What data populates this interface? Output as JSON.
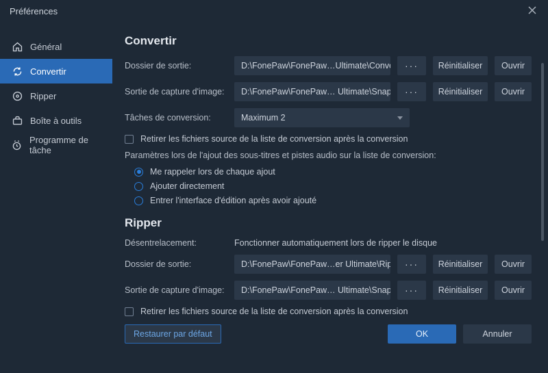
{
  "titlebar": {
    "title": "Préférences"
  },
  "sidebar": {
    "items": [
      {
        "label": "Général"
      },
      {
        "label": "Convertir"
      },
      {
        "label": "Ripper"
      },
      {
        "label": "Boîte à outils"
      },
      {
        "label": "Programme de tâche"
      }
    ],
    "active_index": 1
  },
  "convert": {
    "heading": "Convertir",
    "output_label": "Dossier de sortie:",
    "output_value": "D:\\FonePaw\\FonePaw…Ultimate\\Converted",
    "snapshot_label": "Sortie de capture d'image:",
    "snapshot_value": "D:\\FonePaw\\FonePaw… Ultimate\\Snapshot",
    "tasks_label": "Tâches de conversion:",
    "tasks_value": "Maximum 2",
    "checkbox1": "Retirer les fichiers source de la liste de conversion après la conversion",
    "subparams": "Paramètres lors de l'ajout des sous-titres et pistes audio sur la liste de conversion:",
    "radio1": "Me rappeler lors de chaque ajout",
    "radio2": "Ajouter directement",
    "radio3": "Entrer l'interface d'édition après avoir ajouté"
  },
  "ripper": {
    "heading": "Ripper",
    "deinterlace_label": "Désentrelacement:",
    "deinterlace_value": "Fonctionner automatiquement lors de ripper le disque",
    "output_label": "Dossier de sortie:",
    "output_value": "D:\\FonePaw\\FonePaw…er Ultimate\\Ripper",
    "snapshot_label": "Sortie de capture d'image:",
    "snapshot_value": "D:\\FonePaw\\FonePaw… Ultimate\\Snapshot",
    "checkbox1": "Retirer les fichiers source de la liste de conversion après la conversion"
  },
  "buttons": {
    "browse": "···",
    "reset": "Réinitialiser",
    "open": "Ouvrir",
    "restore": "Restaurer par défaut",
    "ok": "OK",
    "cancel": "Annuler"
  }
}
